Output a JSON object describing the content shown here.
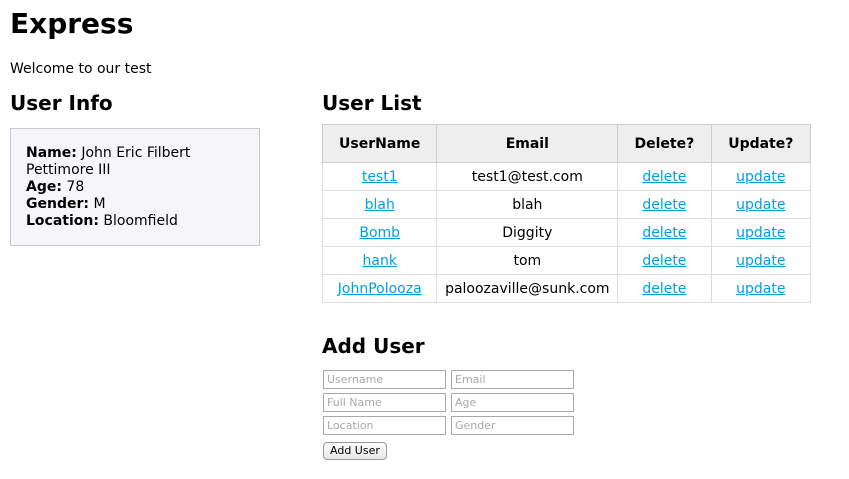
{
  "app": {
    "title": "Express",
    "welcome": "Welcome to our test"
  },
  "user_info": {
    "heading": "User Info",
    "fields": [
      {
        "label": "Name:",
        "value": "John Eric Filbert Pettimore III"
      },
      {
        "label": "Age:",
        "value": "78"
      },
      {
        "label": "Gender:",
        "value": "M"
      },
      {
        "label": "Location:",
        "value": "Bloomfield"
      }
    ]
  },
  "user_list": {
    "heading": "User List",
    "columns": [
      "UserName",
      "Email",
      "Delete?",
      "Update?"
    ],
    "rows": [
      {
        "username": "test1",
        "email": "test1@test.com",
        "delete": "delete",
        "update": "update"
      },
      {
        "username": "blah",
        "email": "blah",
        "delete": "delete",
        "update": "update"
      },
      {
        "username": "Bomb",
        "email": "Diggity",
        "delete": "delete",
        "update": "update"
      },
      {
        "username": "hank",
        "email": "tom",
        "delete": "delete",
        "update": "update"
      },
      {
        "username": "JohnPolooza",
        "email": "paloozaville@sunk.com",
        "delete": "delete",
        "update": "update"
      }
    ]
  },
  "add_user": {
    "heading": "Add User",
    "username_placeholder": "Username",
    "email_placeholder": "Email",
    "fullname_placeholder": "Full Name",
    "age_placeholder": "Age",
    "location_placeholder": "Location",
    "gender_placeholder": "Gender",
    "button_label": "Add User"
  },
  "colors": {
    "link": "#00a0e0",
    "header_bg": "#eeeeee",
    "info_box_bg": "#f6f6fa"
  }
}
